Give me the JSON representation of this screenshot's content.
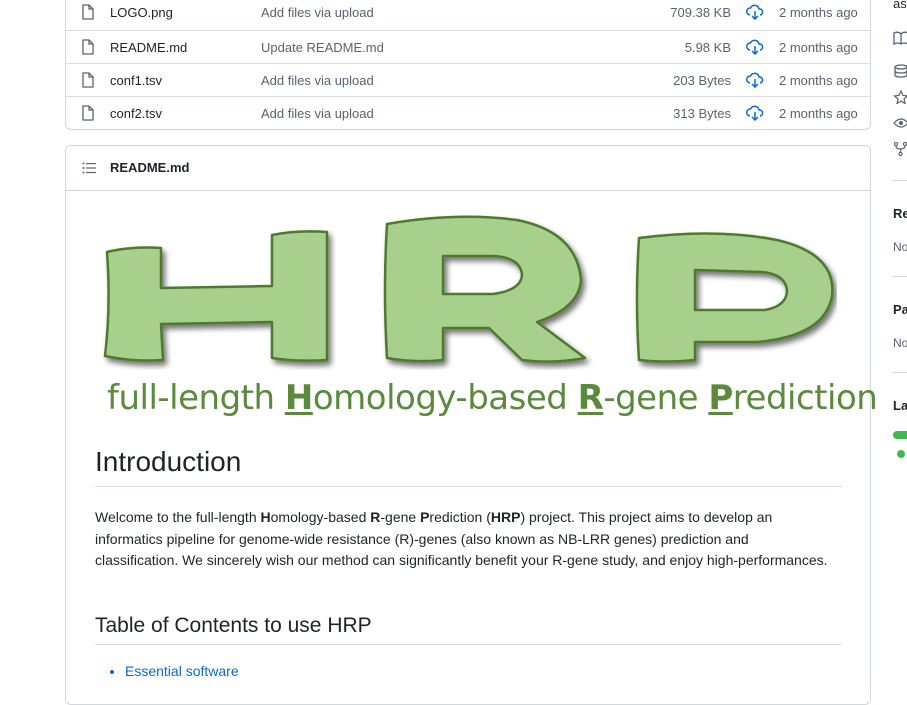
{
  "files": [
    {
      "name": "LOGO.png",
      "message": "Add files via upload",
      "size": "709.38 KB",
      "age": "2 months ago"
    },
    {
      "name": "README.md",
      "message": "Update README.md",
      "size": "5.98 KB",
      "age": "2 months ago"
    },
    {
      "name": "conf1.tsv",
      "message": "Add files via upload",
      "size": "203 Bytes",
      "age": "2 months ago"
    },
    {
      "name": "conf2.tsv",
      "message": "Add files via upload",
      "size": "313 Bytes",
      "age": "2 months ago"
    }
  ],
  "readme": {
    "header_title": "README.md",
    "logo_letters": [
      "H",
      "R",
      "P"
    ],
    "tagline": {
      "part1": "full-length ",
      "h": "H",
      "part2": "omology-based ",
      "r": "R",
      "part3": "-gene ",
      "p": "P",
      "part4": "rediction"
    },
    "intro_heading": "Introduction",
    "intro_paragraph": {
      "p1": "Welcome to the full-length ",
      "h": "H",
      "p2": "omology-based ",
      "r": "R",
      "p3": "-gene ",
      "p": "P",
      "p4": "rediction (",
      "hrp": "HRP",
      "p5": ") project. This project aims to develop an informatics pipeline for genome-wide resistance (R)-genes (also known as NB-LRR genes) prediction and classification. We sincerely wish our method can significantly benefit your R-gene study, and enjoy high-performances."
    },
    "toc_heading": "Table of Contents to use HRP",
    "toc_items": [
      "Essential software"
    ]
  },
  "sidebar": {
    "top_text": "as",
    "releases_heading": "Re",
    "releases_text": "No",
    "packages_heading": "Pa",
    "packages_text": "No",
    "languages_heading": "La"
  },
  "colors": {
    "link": "#0969da",
    "logo_fill": "#a8d08d",
    "logo_stroke": "#4f7a2e",
    "tagline": "#5b8a3c",
    "language_bar": "#3fb950"
  },
  "icons": [
    "file-icon",
    "download-icon",
    "list-icon",
    "book-icon",
    "database-icon",
    "star-icon",
    "eye-icon",
    "fork-icon"
  ]
}
